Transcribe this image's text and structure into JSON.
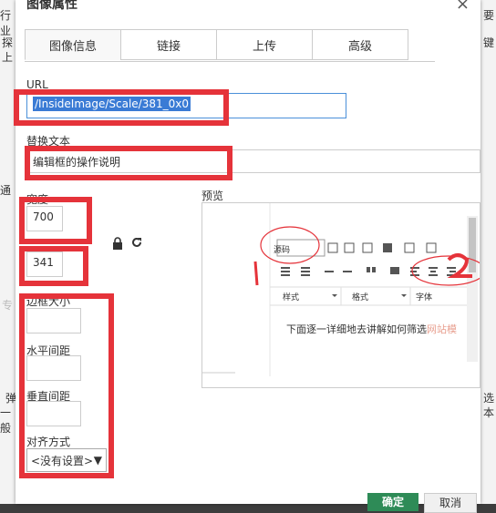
{
  "dialog": {
    "title": "图像属性",
    "close_glyph": "×"
  },
  "background": {
    "left_items": [
      "行业",
      "探",
      "上",
      "通",
      "专",
      "弹",
      "一般"
    ],
    "right_items": [
      "要",
      "键",
      "选",
      "本"
    ]
  },
  "tabs": [
    {
      "label": "图像信息",
      "active": true
    },
    {
      "label": "链接",
      "active": false
    },
    {
      "label": "上传",
      "active": false
    },
    {
      "label": "高级",
      "active": false
    }
  ],
  "form": {
    "url_label": "URL",
    "url_value": "/InsideImage/Scale/381_0x0",
    "alt_label": "替换文本",
    "alt_value": "编辑框的操作说明",
    "width_label": "宽度",
    "width_value": "700",
    "height_value": "341",
    "border_label": "边框大小",
    "hspace_label": "水平间距",
    "vspace_label": "垂直间距",
    "align_label": "对齐方式",
    "align_value": "<没有设置>",
    "preview_label": "预览"
  },
  "preview": {
    "source_button": "源码",
    "style_dropdown": "样式",
    "format_dropdown": "格式",
    "font_dropdown": "字体",
    "body_text": "下面逐一详细地去讲解如何筛选",
    "body_highlight": "网站模",
    "annotation_1": "1",
    "annotation_2": "2"
  },
  "buttons": {
    "ok": "确定",
    "cancel": "取消"
  },
  "colors": {
    "highlight_red": "#e5333a",
    "ok_green": "#2e8b57",
    "selection_blue": "#3a7bd5"
  }
}
